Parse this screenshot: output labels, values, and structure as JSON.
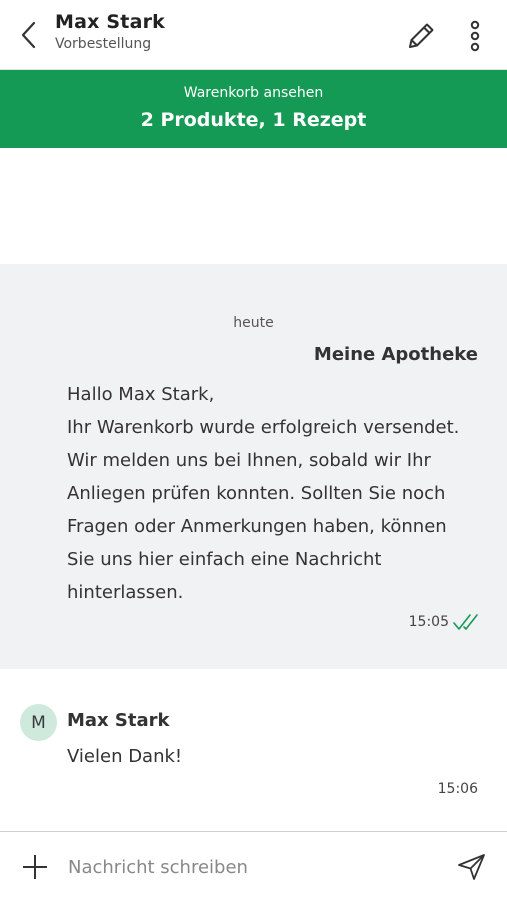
{
  "header": {
    "title": "Max Stark",
    "subtitle": "Vorbestellung",
    "back_icon": "chevron-left-icon",
    "edit_icon": "pencil-icon",
    "more_icon": "more-vertical-icon"
  },
  "cart_banner": {
    "label": "Warenkorb ansehen",
    "summary": "2 Produkte, 1 Rezept",
    "color": "#159a55"
  },
  "conversation": {
    "day_label": "heute",
    "messages": [
      {
        "sender": "Meine Apotheke",
        "lines": [
          "Hallo Max Stark,",
          "Ihr Warenkorb wurde erfolgreich versendet.",
          "Wir melden uns bei Ihnen, sobald wir Ihr",
          "Anliegen prüfen konnten. Sollten Sie noch",
          "Fragen oder Anmerkungen haben, können",
          "Sie uns hier einfach eine Nachricht",
          "hinterlassen."
        ],
        "time": "15:05",
        "status_icon": "double-check-icon"
      },
      {
        "sender": "Max Stark",
        "avatar_initial": "M",
        "text": "Vielen Dank!",
        "time": "15:06"
      }
    ]
  },
  "composer": {
    "placeholder": "Nachricht schreiben",
    "value": "",
    "attach_icon": "plus-icon",
    "send_icon": "send-icon"
  }
}
